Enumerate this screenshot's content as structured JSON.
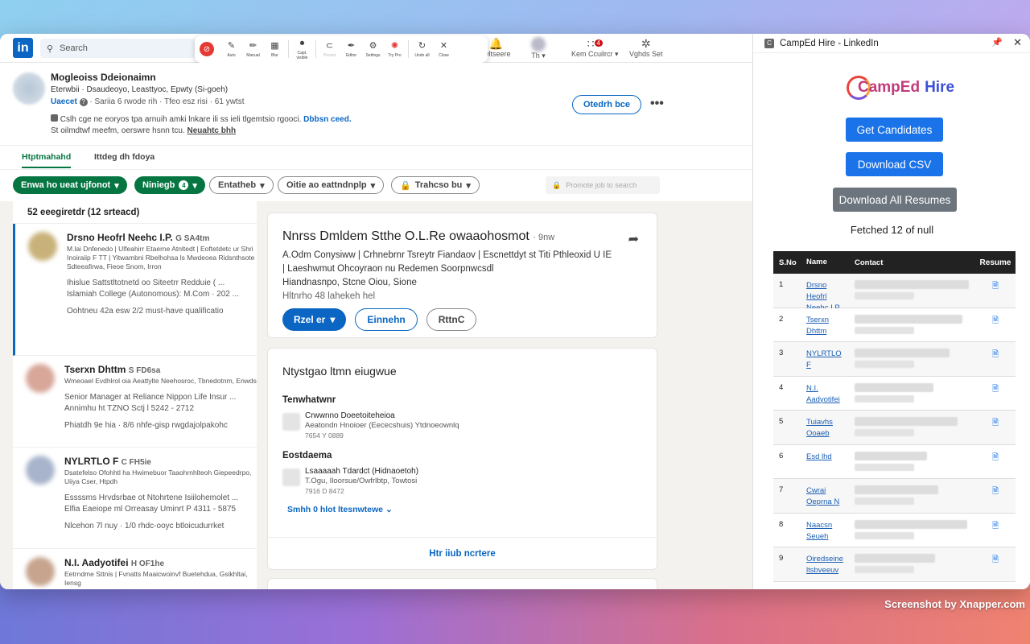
{
  "topnav": {
    "search_placeholder": "Search",
    "messaging_label": "rwltseere",
    "me_label": "Th",
    "work_label": "Kem Ccuilrcr",
    "work_badge": "4",
    "jobs_label": "Vghds Set"
  },
  "capture_toolbar": {
    "items": [
      {
        "label": "Auto",
        "glyph": "✎"
      },
      {
        "label": "Manual",
        "glyph": "✏"
      },
      {
        "label": "Blur",
        "glyph": "▦"
      },
      {
        "label": "Capt. visible",
        "glyph": "⏺"
      },
      {
        "label": "Persist",
        "glyph": "⊂"
      },
      {
        "label": "Editor",
        "glyph": "✒"
      },
      {
        "label": "Settings",
        "glyph": "⚙"
      },
      {
        "label": "Try Pro",
        "glyph": "✺"
      },
      {
        "label": "Undo all",
        "glyph": "↻"
      },
      {
        "label": "Close",
        "glyph": "✕"
      }
    ]
  },
  "job_header": {
    "title": "Mogleoiss Ddeionaimn",
    "subtitle": "Eterwbii · Dsaudeoyo, Leasttyoc, Epwty (Si-goeh)",
    "status": "Uaecet",
    "meta": "· Sariia 6 rwode rih · Tfeo esz risi · 61 ywtst",
    "info_text": "Cslh cge ne eoryos tpa arnuih amki lnkare ili ss ieli tlgemtsio rgooci.",
    "info_link": "Dbbsn ceed.",
    "info2_text": "St oilmdtwf meefm, oerswre hsnn tcu.",
    "info2_link": "Neuahtc bhh",
    "action_button": "Otedrh bce"
  },
  "tabs": [
    "Htptmahahd",
    "Ittdeg dh fdoya"
  ],
  "filters": {
    "chip1": "Enwa ho ueat ujfonot",
    "chip2": "Niniegb",
    "chip2_badge": "4",
    "chip3": "Entatheb",
    "chip4": "Oitie ao eattndnplp",
    "chip5": "Trahcso bu",
    "promote_placeholder": "Promote job to search"
  },
  "applicants": {
    "count": "52 eeegiretdr (12 srteacd)",
    "items": [
      {
        "name": "Drsno Heofrl Neehc I.P.",
        "degree": "G SA4tm",
        "headline": "M.lai Dnfenedo | Ulfeahirr Etaerne Atnltedt | Eoftetdetc ur Shri Inoiraiip F TT | Yitwambni Rbelhohsa ls Mwdeoea Ridsnthsote Sdteeafirwa, Fieoe Snom, Irron",
        "exp1": "Ihislue Sattstltotnetd oo Siteetrr Redduie ( ...",
        "exp2": "Islamiah College (Autonomous): M.Com · 202 ...",
        "footer": "Oohtneu 42a esw   2/2 must-have qualificatio",
        "avatar": "#c9b27a"
      },
      {
        "name": "Tserxn Dhttm",
        "degree": "S FD6sa",
        "headline": "Wmeoael Evdhlrol oia Aeattylte Neehosroc, Tbnedotnm, Enwds",
        "exp1": "Senior Manager at Reliance Nippon Life Insur ...",
        "exp2": "Annimhu ht TZNO Sctj l 5242 - 2712",
        "footer": "Phiatdh 9e hia · 8/6 nhfe-gisp rwgdajolpakohc",
        "avatar": "#d8a79a"
      },
      {
        "name": "NYLRTLO F",
        "degree": "C FH5ie",
        "headline": "Dsatefelso Ofohhtl ha Hwimebuor Taaohrnhlteoh Giepeedrpo, Uiiya Cser, Htpdh",
        "exp1": "Essssms Hrvdsrbae ot Ntohrtene Isiilohemolet ...",
        "exp2": "Elfia Eaeiope ml Orreasay Uminrt P 4311 - 5875",
        "footer": "Nlcehon 7l nuy · 1/0 rhdc-ooyc btloicudurrket",
        "avatar": "#a8b4cc"
      },
      {
        "name": "N.I. Aadyotifei",
        "degree": "H OF1he",
        "headline": "Eetrndme Sttnis | Fvnatts Maaicwoinvf Buetehdua, Gsikhltai, Iensg",
        "exp1": "",
        "exp2": "",
        "footer": "",
        "avatar": "#c7a48e"
      }
    ]
  },
  "detail": {
    "name": "Nnrss Dmldem Stthe O.L.Re owaaohosmot",
    "time": "· 9nw",
    "line1": "A.Odm Conysiww | Crhnebrnr Tsreytr Fiandaov | Escnettdyt st Titi Pthleoxid U IE",
    "line2": "| Laeshwmut Ohcoyraon nu Redemen Soorpnwcsdl",
    "location": "Hiandnasnpo, Stcne Oiou, Sione",
    "misc": "Hltnrho 48 lahekeh hel",
    "primary_button": "Rzel er",
    "secondary_button": "Einnehn",
    "tertiary_button": "RttnC"
  },
  "experience": {
    "heading": "Ntystgao ltmn eiugwue",
    "section1": "Tenwhatwnr",
    "entry1_title": "Crwwnno Doeetoiteheioa",
    "entry1_sub": "Aeatondn Hnoioer (Eececshuis) Ytdnoeownlq",
    "entry1_date": "7654 Y 0889",
    "section2": "Eostdaema",
    "entry2_title": "Lsaaaaah Tdardct (Hidnaoetoh)",
    "entry2_sub": "T.Ogu, Iloorsue/Owfrlbtp, Towtosi",
    "entry2_date": "7916 D 8472",
    "see_more": "Smhh 0 hlot ltesnwtewe",
    "footer_link": "Htr iiub ncrtere"
  },
  "extension": {
    "window_title": "CampEd Hire - LinkedIn",
    "brand_a": "CampEd",
    "brand_b": "Hire",
    "btn_candidates": "Get Candidates",
    "btn_csv": "Download CSV",
    "btn_resumes": "Download All Resumes",
    "fetched": "Fetched 12 of null",
    "columns": [
      "S.No",
      "Name",
      "Contact",
      "Resume"
    ],
    "rows": [
      {
        "no": "1",
        "name": "Drsno Heofrl Neehc I.P."
      },
      {
        "no": "2",
        "name": "Tserxn Dhttm"
      },
      {
        "no": "3",
        "name": "NYLRTLO F"
      },
      {
        "no": "4",
        "name": "N.I. Aadyotifei"
      },
      {
        "no": "5",
        "name": "Tuiavhs Ooaeb"
      },
      {
        "no": "6",
        "name": "Esd lhd"
      },
      {
        "no": "7",
        "name": "Cwrai Oeprna N"
      },
      {
        "no": "8",
        "name": "Naacsn Seueh"
      },
      {
        "no": "9",
        "name": "Oiredseine ltsbveeuv"
      }
    ]
  },
  "credit": "Screenshot by Xnapper.com",
  "colors": {
    "linkedin_blue": "#0a66c2",
    "linkedin_green": "#057642",
    "ext_blue": "#1a73e8",
    "ext_gray": "#6c757d"
  }
}
